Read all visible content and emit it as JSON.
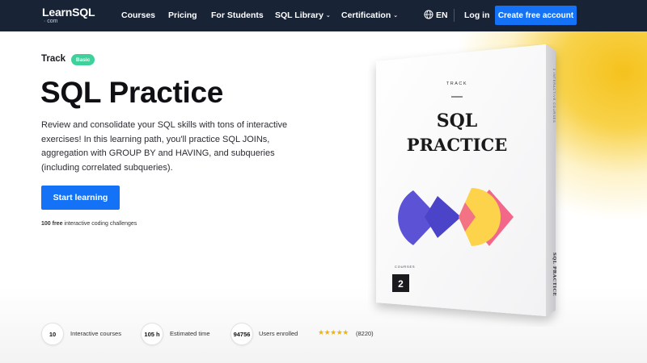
{
  "nav": {
    "logo_brand": "LearnSQL",
    "logo_suffix": "· com",
    "items": [
      {
        "label": "Courses",
        "has_dropdown": false
      },
      {
        "label": "Pricing",
        "has_dropdown": false
      },
      {
        "label": "For Students",
        "has_dropdown": false
      },
      {
        "label": "SQL Library",
        "has_dropdown": true
      },
      {
        "label": "Certification",
        "has_dropdown": true
      }
    ],
    "language": "EN",
    "login": "Log in",
    "cta": "Create free account",
    "globe_icon": "globe-icon",
    "dropdown_icon": "chevron-down-icon"
  },
  "hero": {
    "track_label": "Track",
    "level_badge": "Basic",
    "title": "SQL Practice",
    "description": "Review and consolidate your SQL skills with tons of interactive exercises! In this learning path, you'll practice SQL JOINs, aggregation with GROUP BY and HAVING, and subqueries (including correlated subqueries).",
    "start_button": "Start learning",
    "challenges_count": "100 free",
    "challenges_text": " interactive coding challenges"
  },
  "box": {
    "front_track": "TRACK",
    "front_title_line1": "SQL",
    "front_title_line2": "PRACTICE",
    "courses_label": "COURSES",
    "courses_count": "2",
    "side_top_text": "2 INTERACTIVE COURSES",
    "side_bottom_text": "SQL PRACTICE"
  },
  "stats": {
    "courses_value": "10",
    "courses_label": "Interactive courses",
    "time_value": "105 h",
    "time_label": "Estimated time",
    "users_value": "94756",
    "users_label": "Users enrolled",
    "rating_stars": 5,
    "stars_glyphs": "★★★★★",
    "rating_count": "(8220)"
  },
  "colors": {
    "nav_bg": "#182336",
    "primary": "#1372f5",
    "badge_green": "#3ed19c",
    "glow_yellow": "#f5c21d",
    "shape_purple": "#5b52d6",
    "shape_yellow": "#fcd34a",
    "shape_pink": "#f2678a"
  }
}
